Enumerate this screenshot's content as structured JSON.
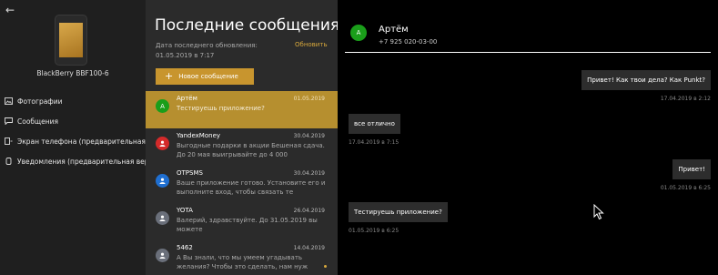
{
  "sidebar": {
    "device_name": "BlackBerry BBF100-6",
    "nav": [
      {
        "label": "Фотографии",
        "icon": "photo-icon"
      },
      {
        "label": "Сообщения",
        "icon": "message-icon"
      },
      {
        "label": "Экран телефона (предварительная версия)",
        "icon": "phone-screen-icon"
      },
      {
        "label": "Уведомления (предварительная версия)",
        "icon": "notification-icon"
      }
    ]
  },
  "messages_panel": {
    "title": "Последние сообщения",
    "last_update": "Дата последнего обновления: 01.05.2019 в 7:17",
    "refresh_label": "Обновить",
    "new_message_label": "Новое сообщение",
    "conversations": [
      {
        "name": "Артём",
        "date": "01.05.2019",
        "preview": "Тестируешь приложение?",
        "avatar_letter": "А",
        "avatar_color": "#1a9e1a",
        "active": true,
        "unread": false
      },
      {
        "name": "YandexMoney",
        "date": "30.04.2019",
        "preview": "Выгодные подарки в акции Бешеная сдача. До 20 мая выигрывайте до 4 000",
        "avatar_letter": "",
        "avatar_color": "#d42a2a",
        "active": false,
        "unread": false
      },
      {
        "name": "OTPSMS",
        "date": "30.04.2019",
        "preview": "Ваше приложение готово. Установите его и выполните вход, чтобы связать те",
        "avatar_letter": "",
        "avatar_color": "#1f6fd1",
        "active": false,
        "unread": false
      },
      {
        "name": "YOTA",
        "date": "26.04.2019",
        "preview": "Валерий, здравствуйте. До 31.05.2019 вы можете",
        "avatar_letter": "",
        "avatar_color": "#6a6f7a",
        "active": false,
        "unread": false
      },
      {
        "name": "5462",
        "date": "14.04.2019",
        "preview": "А Вы знали, что мы умеем угадывать желания? Чтобы это сделать, нам нуж",
        "avatar_letter": "",
        "avatar_color": "#6a6f7a",
        "active": false,
        "unread": true
      }
    ]
  },
  "chat": {
    "contact_name": "Артём",
    "contact_phone": "+7 925 020-03-00",
    "avatar_letter": "А",
    "messages": [
      {
        "text": "Привет! Как твои дела? Как Punkt?",
        "time": "17.04.2019 в 2:12",
        "side": "out"
      },
      {
        "text": "все отлично",
        "time": "17.04.2019 в 7:15",
        "side": "in"
      },
      {
        "text": "Привет!",
        "time": "01.05.2019 в 6:25",
        "side": "out"
      },
      {
        "text": "Тестируешь приложение?",
        "time": "01.05.2019 в 6:25",
        "side": "in"
      }
    ]
  },
  "colors": {
    "accent": "#c8952e",
    "active_row": "#b68f2f",
    "sidebar_bg": "#1f1f1f",
    "list_bg": "#2b2b2b",
    "chat_bg": "#000000",
    "bubble_bg": "#2d2d2d"
  }
}
